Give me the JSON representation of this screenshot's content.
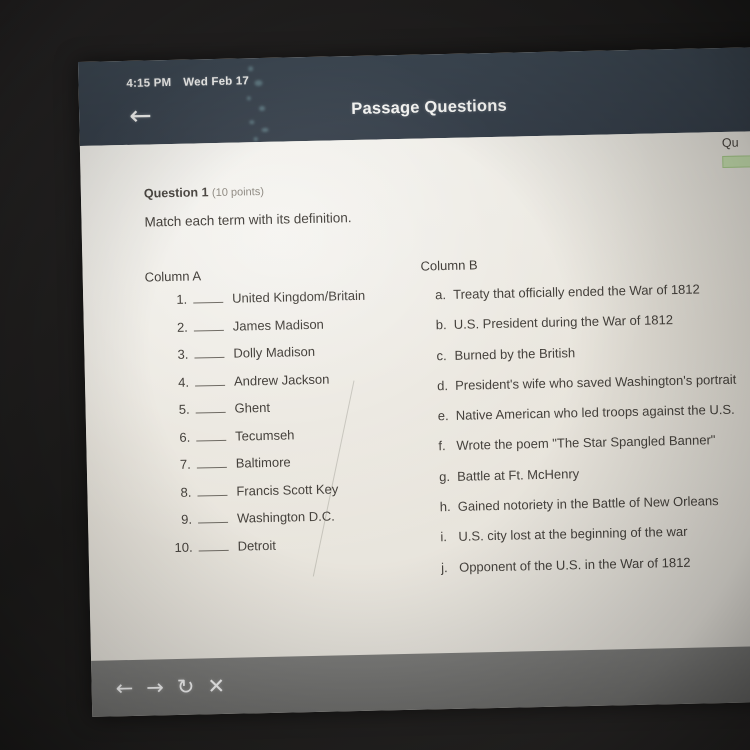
{
  "status_bar": {
    "time": "4:15 PM",
    "date": "Wed Feb 17"
  },
  "app_bar": {
    "back_icon": "back-arrow-icon",
    "title": "Passage Questions"
  },
  "question": {
    "label": "Question 1",
    "points": "(10 points)",
    "prompt": "Match each term with its definition."
  },
  "column_a": {
    "heading": "Column A",
    "items": [
      {
        "number": "1.",
        "term": "United Kingdom/Britain",
        "answer": ""
      },
      {
        "number": "2.",
        "term": "James Madison",
        "answer": ""
      },
      {
        "number": "3.",
        "term": "Dolly Madison",
        "answer": ""
      },
      {
        "number": "4.",
        "term": "Andrew Jackson",
        "answer": ""
      },
      {
        "number": "5.",
        "term": "Ghent",
        "answer": ""
      },
      {
        "number": "6.",
        "term": "Tecumseh",
        "answer": ""
      },
      {
        "number": "7.",
        "term": "Baltimore",
        "answer": ""
      },
      {
        "number": "8.",
        "term": "Francis Scott Key",
        "answer": ""
      },
      {
        "number": "9.",
        "term": "Washington D.C.",
        "answer": ""
      },
      {
        "number": "10.",
        "term": "Detroit",
        "answer": ""
      }
    ]
  },
  "column_b": {
    "heading": "Column B",
    "items": [
      {
        "letter": "a.",
        "text": "Treaty that officially ended the War of 1812"
      },
      {
        "letter": "b.",
        "text": "U.S. President during the War of 1812"
      },
      {
        "letter": "c.",
        "text": "Burned by the British"
      },
      {
        "letter": "d.",
        "text": "President's wife who saved Washington's portrait"
      },
      {
        "letter": "e.",
        "text": "Native American who led troops against the U.S."
      },
      {
        "letter": "f.",
        "text": "Wrote the poem \"The Star Spangled Banner\""
      },
      {
        "letter": "g.",
        "text": "Battle at Ft. McHenry"
      },
      {
        "letter": "h.",
        "text": "Gained notoriety in the Battle of New Orleans"
      },
      {
        "letter": "i.",
        "text": "U.S. city lost at the beginning of the war"
      },
      {
        "letter": "j.",
        "text": "Opponent of the U.S. in the War of 1812"
      }
    ]
  },
  "next_question_panel": {
    "partial_label": "Qu",
    "highlight_color": "#c9e2b1"
  },
  "bottom_bar": {
    "icons": [
      {
        "name": "back-icon",
        "glyph": "←"
      },
      {
        "name": "forward-icon",
        "glyph": "→"
      },
      {
        "name": "reload-icon",
        "glyph": "↻"
      },
      {
        "name": "close-icon",
        "glyph": "✕"
      }
    ]
  },
  "colors": {
    "app_bar": "#3a4450",
    "paper": "#e9e5dd",
    "bottom_bar": "#7a7a78",
    "text": "#45413c"
  }
}
